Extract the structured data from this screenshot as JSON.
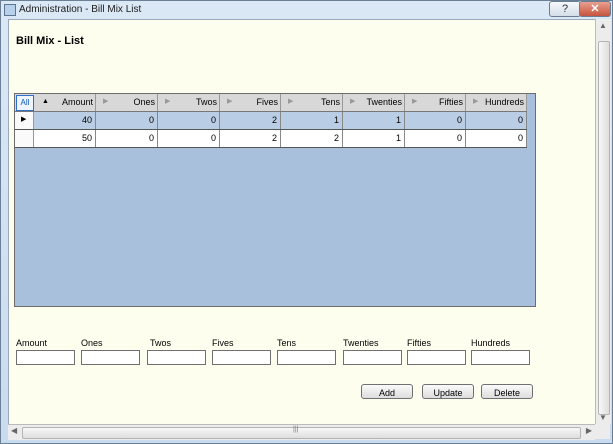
{
  "window": {
    "title": "Administration - Bill Mix List",
    "help_symbol": "?",
    "close_symbol": "✕"
  },
  "page": {
    "title": "Bill Mix - List"
  },
  "grid": {
    "all_label": "All",
    "columns": [
      {
        "label": "Amount",
        "sorted": "ascending"
      },
      {
        "label": "Ones",
        "sorted": "none"
      },
      {
        "label": "Twos",
        "sorted": "none"
      },
      {
        "label": "Fives",
        "sorted": "none"
      },
      {
        "label": "Tens",
        "sorted": "none"
      },
      {
        "label": "Twenties",
        "sorted": "none"
      },
      {
        "label": "Fifties",
        "sorted": "none"
      },
      {
        "label": "Hundreds",
        "sorted": "none"
      }
    ],
    "rows": [
      {
        "selected": true,
        "cells": [
          "40",
          "0",
          "0",
          "2",
          "1",
          "1",
          "0",
          "0"
        ]
      },
      {
        "selected": false,
        "cells": [
          "50",
          "0",
          "0",
          "2",
          "2",
          "1",
          "0",
          "0"
        ]
      }
    ]
  },
  "form": {
    "fields": [
      {
        "label": "Amount",
        "value": ""
      },
      {
        "label": "Ones",
        "value": ""
      },
      {
        "label": "Twos",
        "value": ""
      },
      {
        "label": "Fives",
        "value": ""
      },
      {
        "label": "Tens",
        "value": ""
      },
      {
        "label": "Twenties",
        "value": ""
      },
      {
        "label": "Fifties",
        "value": ""
      },
      {
        "label": "Hundreds",
        "value": ""
      }
    ],
    "buttons": {
      "add_label": "Add",
      "update_label": "Update",
      "delete_label": "Delete"
    }
  },
  "icons": {
    "sort_ascending": "▲",
    "column_handle": "▶",
    "row_pointer": "▶",
    "scroll_up": "▲",
    "scroll_down": "▼",
    "scroll_left": "◀",
    "scroll_right": "▶",
    "grip": "|||"
  },
  "colors": {
    "grid_background": "#a9c0dc",
    "selected_row": "#b9cde5",
    "form_background": "#fefeef"
  }
}
